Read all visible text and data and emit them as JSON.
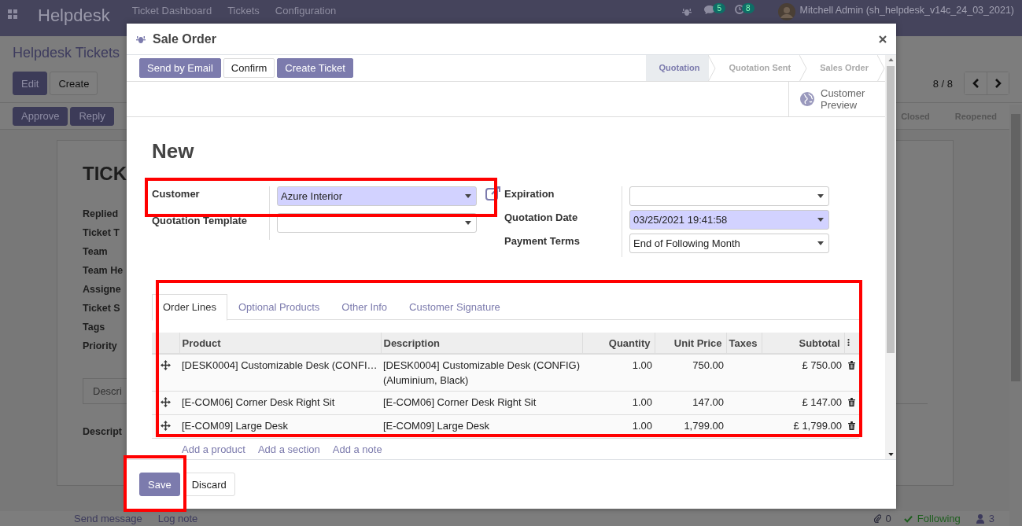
{
  "navbar": {
    "app": "Helpdesk",
    "menus": [
      "Ticket Dashboard",
      "Tickets",
      "Configuration"
    ],
    "chat_count": "5",
    "activity_count": "8",
    "user": "Mitchell Admin (sh_helpdesk_v14c_24_03_2021)"
  },
  "background": {
    "breadcrumb": "Helpdesk Tickets",
    "buttons": [
      {
        "label": "Edit",
        "primary": true
      },
      {
        "label": "Create",
        "primary": false
      }
    ],
    "pager": "8 / 8",
    "actions": [
      {
        "label": "Approve",
        "primary": true
      },
      {
        "label": "Reply",
        "primary": true
      }
    ],
    "stages": [
      "Closed",
      "Reopened"
    ],
    "ticket_title": "TICK",
    "field_labels": [
      "Replied",
      "Ticket T",
      "Team",
      "Team He",
      "Assigne",
      "Ticket S",
      "Tags",
      "Priority"
    ],
    "tab": "Descri",
    "description_label": "Descript",
    "chatter": {
      "send_message": "Send message",
      "log_note": "Log note",
      "attachments": "0",
      "following": "Following",
      "followers": "3"
    }
  },
  "dialog": {
    "title": "Sale Order",
    "header_buttons": [
      {
        "label": "Send by Email",
        "primary": true
      },
      {
        "label": "Confirm",
        "primary": false
      },
      {
        "label": "Create Ticket",
        "primary": true
      }
    ],
    "stages": [
      {
        "label": "Quotation",
        "selected": true
      },
      {
        "label": "Quotation Sent",
        "selected": false
      },
      {
        "label": "Sales Order",
        "selected": false
      }
    ],
    "preview_button": "Customer Preview",
    "record_title": "New",
    "left_fields": [
      {
        "label": "Customer",
        "value": "Azure Interior",
        "required": true
      },
      {
        "label": "Quotation Template",
        "required": false
      }
    ],
    "right_fields": [
      {
        "label": "Expiration",
        "required": false
      },
      {
        "label": "Quotation Date",
        "value": "03/25/2021 19:41:58",
        "required": true
      },
      {
        "label": "Payment Terms",
        "value": "End of Following Month",
        "required": false
      }
    ],
    "tabs": [
      {
        "label": "Order Lines",
        "selected": true
      },
      {
        "label": "Optional Products",
        "selected": false
      },
      {
        "label": "Other Info",
        "selected": false
      },
      {
        "label": "Customer Signature",
        "selected": false
      }
    ],
    "table": {
      "columns": [
        "Product",
        "Description",
        "Quantity",
        "Unit Price",
        "Taxes",
        "Subtotal"
      ],
      "rows": [
        {
          "product": "[DESK0004] Customizable Desk (CONFI…",
          "description": "[DESK0004] Customizable Desk (CONFIG) (Aluminium, Black)",
          "quantity": "1.00",
          "unit_price": "750.00",
          "subtotal": "£ 750.00"
        },
        {
          "product": "[E-COM06] Corner Desk Right Sit",
          "description": "[E-COM06] Corner Desk Right Sit",
          "quantity": "1.00",
          "unit_price": "147.00",
          "subtotal": "£ 147.00"
        },
        {
          "product": "[E-COM09] Large Desk",
          "description": "[E-COM09] Large Desk",
          "quantity": "1.00",
          "unit_price": "1,799.00",
          "subtotal": "£ 1,799.00"
        }
      ],
      "add_links": [
        "Add a product",
        "Add a section",
        "Add a note"
      ]
    },
    "footer_buttons": [
      {
        "label": "Save",
        "primary": true
      },
      {
        "label": "Discard",
        "primary": false
      }
    ]
  }
}
